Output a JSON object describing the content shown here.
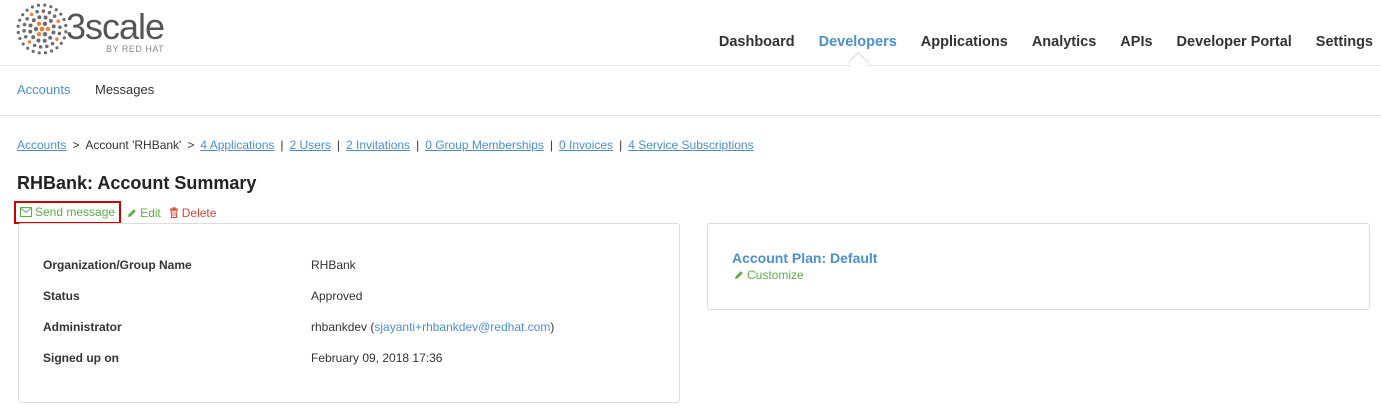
{
  "logo": {
    "brand": "3scale",
    "sub": "BY RED HAT"
  },
  "nav": {
    "items": [
      {
        "label": "Dashboard",
        "active": false
      },
      {
        "label": "Developers",
        "active": true
      },
      {
        "label": "Applications",
        "active": false
      },
      {
        "label": "Analytics",
        "active": false
      },
      {
        "label": "APIs",
        "active": false
      },
      {
        "label": "Developer Portal",
        "active": false
      },
      {
        "label": "Settings",
        "active": false
      }
    ]
  },
  "subnav": {
    "accounts": "Accounts",
    "messages": "Messages"
  },
  "breadcrumb": {
    "root": "Accounts",
    "current": "Account 'RHBank'",
    "links": [
      "4 Applications",
      "2 Users",
      "2 Invitations",
      "0 Group Memberships",
      "0 Invoices",
      "4 Service Subscriptions"
    ]
  },
  "page": {
    "title": "RHBank: Account Summary",
    "actions": {
      "send_message": "Send message",
      "edit": "Edit",
      "delete": "Delete"
    }
  },
  "summary": {
    "org_label": "Organization/Group Name",
    "org_value": "RHBank",
    "status_label": "Status",
    "status_value": "Approved",
    "admin_label": "Administrator",
    "admin_name": "rhbankdev",
    "admin_email": "sjayanti+rhbankdev@redhat.com",
    "signup_label": "Signed up on",
    "signup_value": "February 09, 2018 17:36"
  },
  "plan": {
    "title": "Account Plan: Default",
    "customize": "Customize"
  },
  "colors": {
    "link": "#4c8fc9",
    "green": "#5cae48",
    "red": "#cc4b37",
    "logo_orange": "#e8843a",
    "highlight": "#cc0000"
  }
}
